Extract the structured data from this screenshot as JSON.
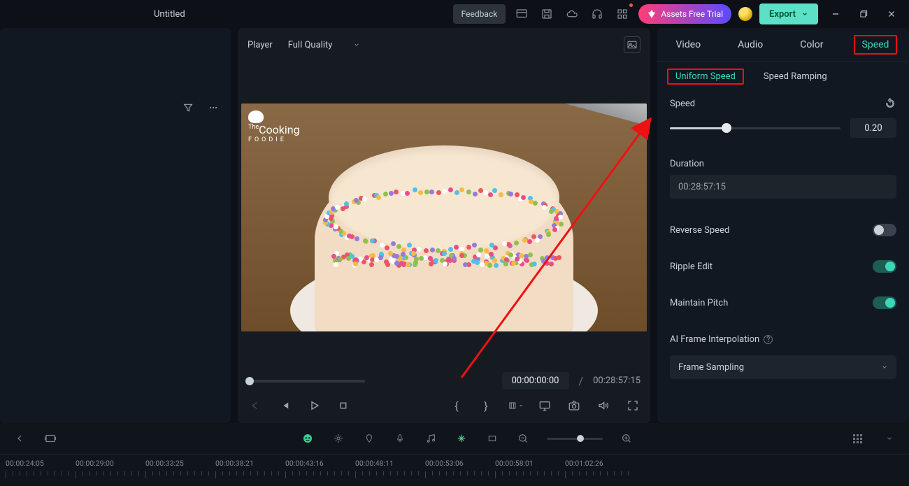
{
  "title": "Untitled",
  "toolbar": {
    "feedback": "Feedback",
    "assets": "Assets Free Trial",
    "export": "Export"
  },
  "player": {
    "label": "Player",
    "quality": "Full Quality",
    "current_time": "00:00:00:00",
    "total_time": "00:28:57:15",
    "divider": "/",
    "logo_line1": "Cooking",
    "logo_line2": "FOODIE",
    "logo_prefix": "The"
  },
  "right": {
    "tabs": {
      "video": "Video",
      "audio": "Audio",
      "color": "Color",
      "speed": "Speed"
    },
    "subtabs": {
      "uniform": "Uniform Speed",
      "ramping": "Speed Ramping"
    },
    "speed_label": "Speed",
    "speed_value": "0.20",
    "speed_slider_percent": 33,
    "duration_label": "Duration",
    "duration_value": "00:28:57:15",
    "reverse_label": "Reverse Speed",
    "reverse_on": false,
    "ripple_label": "Ripple Edit",
    "ripple_on": true,
    "pitch_label": "Maintain Pitch",
    "pitch_on": true,
    "ai_label": "AI Frame Interpolation",
    "ai_select": "Frame Sampling"
  },
  "timeline": {
    "zoom_percent": 60,
    "marks": [
      "00:00:24:05",
      "00:00:29:00",
      "00:00:33:25",
      "00:00:38:21",
      "00:00:43:16",
      "00:00:48:11",
      "00:00:53:06",
      "00:00:58:01",
      "00:01:02:26"
    ]
  }
}
